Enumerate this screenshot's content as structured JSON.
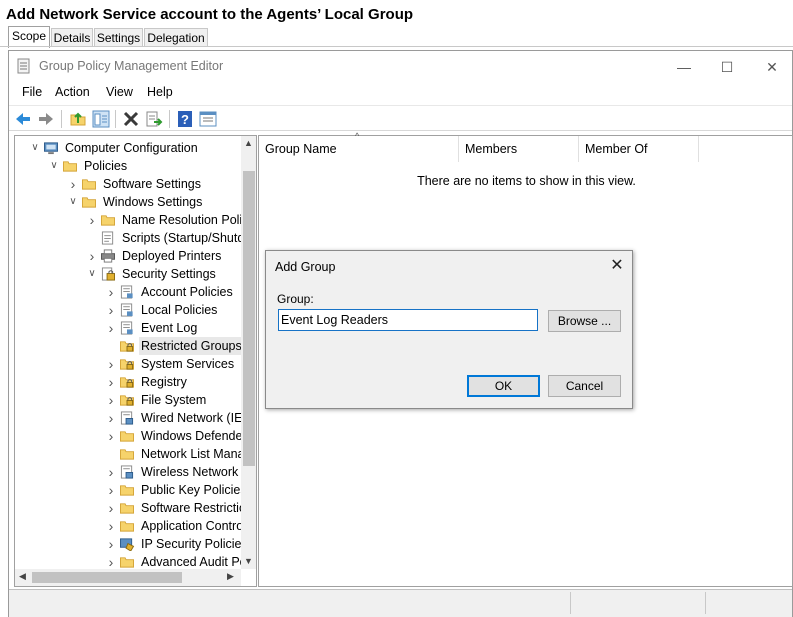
{
  "page_title": "Add Network Service account to the Agents’ Local Group",
  "tabs": [
    {
      "label": "Scope",
      "active": true
    },
    {
      "label": "Details",
      "active": false
    },
    {
      "label": "Settings",
      "active": false
    },
    {
      "label": "Delegation",
      "active": false
    }
  ],
  "window": {
    "title": "Group Policy Management Editor",
    "minimize": "—",
    "maximize": "☐",
    "close": "✕"
  },
  "menu": [
    "File",
    "Action",
    "View",
    "Help"
  ],
  "toolbar_icons": [
    "back-arrow-icon",
    "forward-arrow-icon",
    "up-folder-icon",
    "show-hide-tree-icon",
    "delete-x-icon",
    "export-list-icon",
    "help-icon",
    "properties-icon"
  ],
  "tree": [
    {
      "label": "Computer Configuration",
      "level": 0,
      "expand": "v",
      "icon": "computer"
    },
    {
      "label": "Policies",
      "level": 1,
      "expand": "v",
      "icon": "folder"
    },
    {
      "label": "Software Settings",
      "level": 2,
      "expand": ">",
      "icon": "folder"
    },
    {
      "label": "Windows Settings",
      "level": 2,
      "expand": "v",
      "icon": "folder"
    },
    {
      "label": "Name Resolution Polic",
      "level": 3,
      "expand": ">",
      "icon": "folder"
    },
    {
      "label": "Scripts (Startup/Shutdo",
      "level": 3,
      "expand": "",
      "icon": "script"
    },
    {
      "label": "Deployed Printers",
      "level": 3,
      "expand": ">",
      "icon": "printer"
    },
    {
      "label": "Security Settings",
      "level": 3,
      "expand": "v",
      "icon": "security"
    },
    {
      "label": "Account Policies",
      "level": 4,
      "expand": ">",
      "icon": "policy"
    },
    {
      "label": "Local Policies",
      "level": 4,
      "expand": ">",
      "icon": "policy"
    },
    {
      "label": "Event Log",
      "level": 4,
      "expand": ">",
      "icon": "policy"
    },
    {
      "label": "Restricted Groups",
      "level": 4,
      "expand": "",
      "icon": "lockfolder",
      "selected": true
    },
    {
      "label": "System Services",
      "level": 4,
      "expand": ">",
      "icon": "lockfolder"
    },
    {
      "label": "Registry",
      "level": 4,
      "expand": ">",
      "icon": "lockfolder"
    },
    {
      "label": "File System",
      "level": 4,
      "expand": ">",
      "icon": "lockfolder"
    },
    {
      "label": "Wired Network (IEE",
      "level": 4,
      "expand": ">",
      "icon": "network"
    },
    {
      "label": "Windows Defender",
      "level": 4,
      "expand": ">",
      "icon": "folder"
    },
    {
      "label": "Network List Mana",
      "level": 4,
      "expand": "",
      "icon": "folder"
    },
    {
      "label": "Wireless Network (",
      "level": 4,
      "expand": ">",
      "icon": "network"
    },
    {
      "label": "Public Key Policies",
      "level": 4,
      "expand": ">",
      "icon": "folder"
    },
    {
      "label": "Software Restrictio",
      "level": 4,
      "expand": ">",
      "icon": "folder"
    },
    {
      "label": "Application Contro",
      "level": 4,
      "expand": ">",
      "icon": "folder"
    },
    {
      "label": "IP Security Policies",
      "level": 4,
      "expand": ">",
      "icon": "ipsec"
    },
    {
      "label": "Advanced Audit Po",
      "level": 4,
      "expand": ">",
      "icon": "folder"
    }
  ],
  "list": {
    "columns": [
      "Group Name",
      "Members",
      "Member Of"
    ],
    "empty_message": "There are no items to show in this view."
  },
  "dialog": {
    "title": "Add Group",
    "close": "✕",
    "group_label": "Group:",
    "group_value": "Event Log Readers",
    "browse_label": "Browse ...",
    "ok_label": "OK",
    "cancel_label": "Cancel"
  },
  "colors": {
    "accent": "#0078d7",
    "folder": "#f6d36b",
    "folder_edge": "#d4a437"
  }
}
